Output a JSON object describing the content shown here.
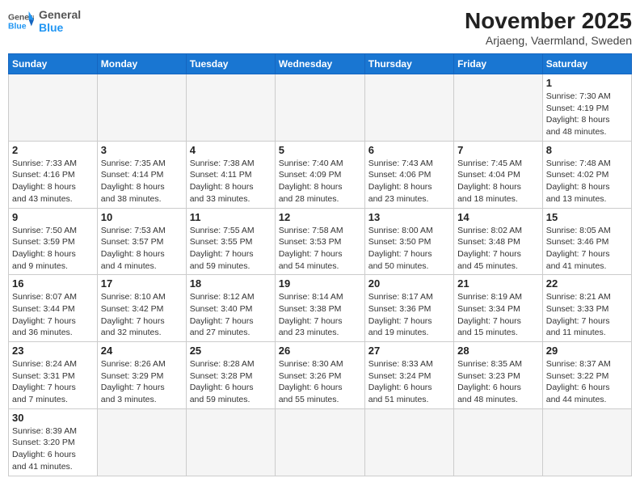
{
  "header": {
    "logo_general": "General",
    "logo_blue": "Blue",
    "month_title": "November 2025",
    "subtitle": "Arjaeng, Vaermland, Sweden"
  },
  "weekdays": [
    "Sunday",
    "Monday",
    "Tuesday",
    "Wednesday",
    "Thursday",
    "Friday",
    "Saturday"
  ],
  "weeks": [
    [
      {
        "day": "",
        "info": ""
      },
      {
        "day": "",
        "info": ""
      },
      {
        "day": "",
        "info": ""
      },
      {
        "day": "",
        "info": ""
      },
      {
        "day": "",
        "info": ""
      },
      {
        "day": "",
        "info": ""
      },
      {
        "day": "1",
        "info": "Sunrise: 7:30 AM\nSunset: 4:19 PM\nDaylight: 8 hours\nand 48 minutes."
      }
    ],
    [
      {
        "day": "2",
        "info": "Sunrise: 7:33 AM\nSunset: 4:16 PM\nDaylight: 8 hours\nand 43 minutes."
      },
      {
        "day": "3",
        "info": "Sunrise: 7:35 AM\nSunset: 4:14 PM\nDaylight: 8 hours\nand 38 minutes."
      },
      {
        "day": "4",
        "info": "Sunrise: 7:38 AM\nSunset: 4:11 PM\nDaylight: 8 hours\nand 33 minutes."
      },
      {
        "day": "5",
        "info": "Sunrise: 7:40 AM\nSunset: 4:09 PM\nDaylight: 8 hours\nand 28 minutes."
      },
      {
        "day": "6",
        "info": "Sunrise: 7:43 AM\nSunset: 4:06 PM\nDaylight: 8 hours\nand 23 minutes."
      },
      {
        "day": "7",
        "info": "Sunrise: 7:45 AM\nSunset: 4:04 PM\nDaylight: 8 hours\nand 18 minutes."
      },
      {
        "day": "8",
        "info": "Sunrise: 7:48 AM\nSunset: 4:02 PM\nDaylight: 8 hours\nand 13 minutes."
      }
    ],
    [
      {
        "day": "9",
        "info": "Sunrise: 7:50 AM\nSunset: 3:59 PM\nDaylight: 8 hours\nand 9 minutes."
      },
      {
        "day": "10",
        "info": "Sunrise: 7:53 AM\nSunset: 3:57 PM\nDaylight: 8 hours\nand 4 minutes."
      },
      {
        "day": "11",
        "info": "Sunrise: 7:55 AM\nSunset: 3:55 PM\nDaylight: 7 hours\nand 59 minutes."
      },
      {
        "day": "12",
        "info": "Sunrise: 7:58 AM\nSunset: 3:53 PM\nDaylight: 7 hours\nand 54 minutes."
      },
      {
        "day": "13",
        "info": "Sunrise: 8:00 AM\nSunset: 3:50 PM\nDaylight: 7 hours\nand 50 minutes."
      },
      {
        "day": "14",
        "info": "Sunrise: 8:02 AM\nSunset: 3:48 PM\nDaylight: 7 hours\nand 45 minutes."
      },
      {
        "day": "15",
        "info": "Sunrise: 8:05 AM\nSunset: 3:46 PM\nDaylight: 7 hours\nand 41 minutes."
      }
    ],
    [
      {
        "day": "16",
        "info": "Sunrise: 8:07 AM\nSunset: 3:44 PM\nDaylight: 7 hours\nand 36 minutes."
      },
      {
        "day": "17",
        "info": "Sunrise: 8:10 AM\nSunset: 3:42 PM\nDaylight: 7 hours\nand 32 minutes."
      },
      {
        "day": "18",
        "info": "Sunrise: 8:12 AM\nSunset: 3:40 PM\nDaylight: 7 hours\nand 27 minutes."
      },
      {
        "day": "19",
        "info": "Sunrise: 8:14 AM\nSunset: 3:38 PM\nDaylight: 7 hours\nand 23 minutes."
      },
      {
        "day": "20",
        "info": "Sunrise: 8:17 AM\nSunset: 3:36 PM\nDaylight: 7 hours\nand 19 minutes."
      },
      {
        "day": "21",
        "info": "Sunrise: 8:19 AM\nSunset: 3:34 PM\nDaylight: 7 hours\nand 15 minutes."
      },
      {
        "day": "22",
        "info": "Sunrise: 8:21 AM\nSunset: 3:33 PM\nDaylight: 7 hours\nand 11 minutes."
      }
    ],
    [
      {
        "day": "23",
        "info": "Sunrise: 8:24 AM\nSunset: 3:31 PM\nDaylight: 7 hours\nand 7 minutes."
      },
      {
        "day": "24",
        "info": "Sunrise: 8:26 AM\nSunset: 3:29 PM\nDaylight: 7 hours\nand 3 minutes."
      },
      {
        "day": "25",
        "info": "Sunrise: 8:28 AM\nSunset: 3:28 PM\nDaylight: 6 hours\nand 59 minutes."
      },
      {
        "day": "26",
        "info": "Sunrise: 8:30 AM\nSunset: 3:26 PM\nDaylight: 6 hours\nand 55 minutes."
      },
      {
        "day": "27",
        "info": "Sunrise: 8:33 AM\nSunset: 3:24 PM\nDaylight: 6 hours\nand 51 minutes."
      },
      {
        "day": "28",
        "info": "Sunrise: 8:35 AM\nSunset: 3:23 PM\nDaylight: 6 hours\nand 48 minutes."
      },
      {
        "day": "29",
        "info": "Sunrise: 8:37 AM\nSunset: 3:22 PM\nDaylight: 6 hours\nand 44 minutes."
      }
    ],
    [
      {
        "day": "30",
        "info": "Sunrise: 8:39 AM\nSunset: 3:20 PM\nDaylight: 6 hours\nand 41 minutes."
      },
      {
        "day": "",
        "info": ""
      },
      {
        "day": "",
        "info": ""
      },
      {
        "day": "",
        "info": ""
      },
      {
        "day": "",
        "info": ""
      },
      {
        "day": "",
        "info": ""
      },
      {
        "day": "",
        "info": ""
      }
    ]
  ]
}
